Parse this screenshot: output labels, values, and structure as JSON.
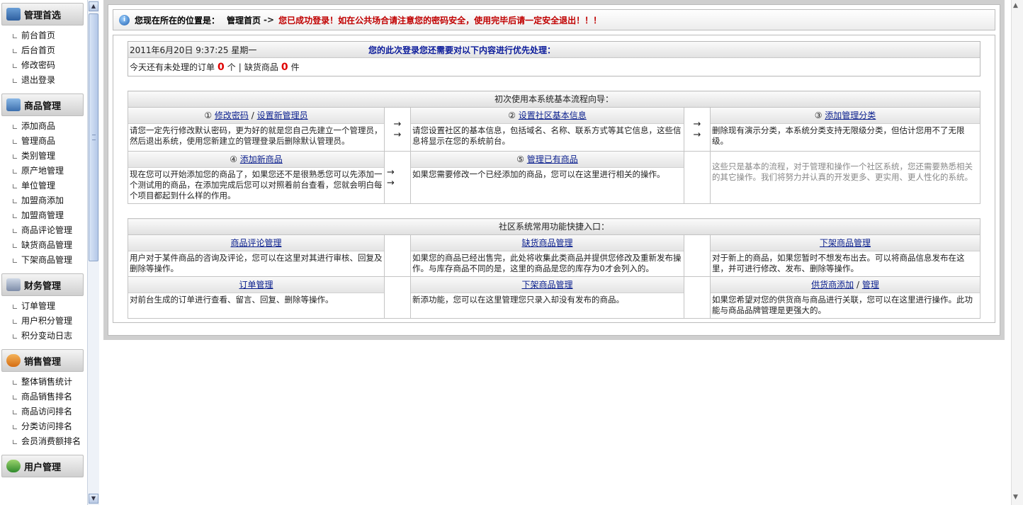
{
  "sidebar": {
    "sections": [
      {
        "title": "管理首选",
        "icon": "home-icon",
        "items": [
          "前台首页",
          "后台首页",
          "修改密码",
          "退出登录"
        ]
      },
      {
        "title": "商品管理",
        "icon": "goods-icon",
        "items": [
          "添加商品",
          "管理商品",
          "类别管理",
          "原产地管理",
          "单位管理",
          "加盟商添加",
          "加盟商管理",
          "商品评论管理",
          "缺货商品管理",
          "下架商品管理"
        ]
      },
      {
        "title": "财务管理",
        "icon": "finance-icon",
        "items": [
          "订单管理",
          "用户积分管理",
          "积分变动日志"
        ]
      },
      {
        "title": "销售管理",
        "icon": "sales-icon",
        "items": [
          "整体销售统计",
          "商品销售排名",
          "商品访问排名",
          "分类访问排名",
          "会员消费额排名"
        ]
      },
      {
        "title": "用户管理",
        "icon": "user-icon",
        "items": []
      }
    ]
  },
  "location": {
    "prefix": "您现在所在的位置是：",
    "page": "管理首页",
    "arrow": "->",
    "warning": "您已成功登录！如在公共场合请注意您的密码安全，使用完毕后请一定安全退出！！！"
  },
  "status": {
    "datetime": "2011年6月20日  9:37:25 星期一",
    "priority": "您的此次登录您还需要对以下内容进行优先处理：",
    "orders_text": "今天还有未处理的订单",
    "orders_count": "0",
    "orders_unit": "个",
    "sep": "|",
    "stock_text": "缺货商品",
    "stock_count": "0",
    "stock_unit": "件"
  },
  "guide": {
    "caption": "初次使用本系统基本流程向导：",
    "arrow": "→",
    "steps": [
      {
        "num": "①",
        "link1": "修改密码",
        "slash": "/",
        "link2": "设置新管理员",
        "desc": "请您一定先行修改默认密码，更为好的就是您自己先建立一个管理员，然后退出系统，使用您新建立的管理登录后删除默认管理员。"
      },
      {
        "num": "②",
        "link1": "设置社区基本信息",
        "desc": "请您设置社区的基本信息，包括域名、名称、联系方式等其它信息，这些信息将显示在您的系统前台。"
      },
      {
        "num": "③",
        "link1": "添加管理分类",
        "desc": "删除现有演示分类，本系统分类支持无限级分类，但估计您用不了无限级。"
      },
      {
        "num": "④",
        "link1": "添加新商品",
        "desc": "现在您可以开始添加您的商品了，如果您还不是很熟悉您可以先添加一个测试用的商品，在添加完成后您可以对照着前台查看，您就会明白每个项目都起到什么样的作用。"
      },
      {
        "num": "⑤",
        "link1": "管理已有商品",
        "desc": "如果您需要修改一个已经添加的商品，您可以在这里进行相关的操作。"
      }
    ],
    "note": "这些只是基本的流程，对于管理和操作一个社区系统，您还需要熟悉相关的其它操作。我们将努力并认真的开发更多、更实用、更人性化的系统。"
  },
  "shortcuts": {
    "caption": "社区系统常用功能快捷入口：",
    "items": [
      {
        "title": "商品评论管理",
        "desc": "用户对于某件商品的咨询及评论，您可以在这里对其进行审核、回复及删除等操作。"
      },
      {
        "title": "缺货商品管理",
        "desc": "如果您的商品已经出售完，此处将收集此类商品并提供您修改及重新发布操作。与库存商品不同的是，这里的商品是您的库存为0才会列入的。"
      },
      {
        "title": "下架商品管理",
        "desc": "对于新上的商品，如果您暂时不想发布出去。可以将商品信息发布在这里，并可进行修改、发布、删除等操作。"
      },
      {
        "title": "订单管理",
        "desc": "对前台生成的订单进行查看、留言、回复、删除等操作。"
      },
      {
        "title": "下架商品管理",
        "desc": "新添功能，您可以在这里管理您只录入却没有发布的商品。"
      },
      {
        "title": "供货商添加",
        "slash": "/",
        "title2": "管理",
        "desc": "如果您希望对您的供货商与商品进行关联，您可以在这里进行操作。此功能与商品品牌管理是更强大的。"
      }
    ]
  }
}
